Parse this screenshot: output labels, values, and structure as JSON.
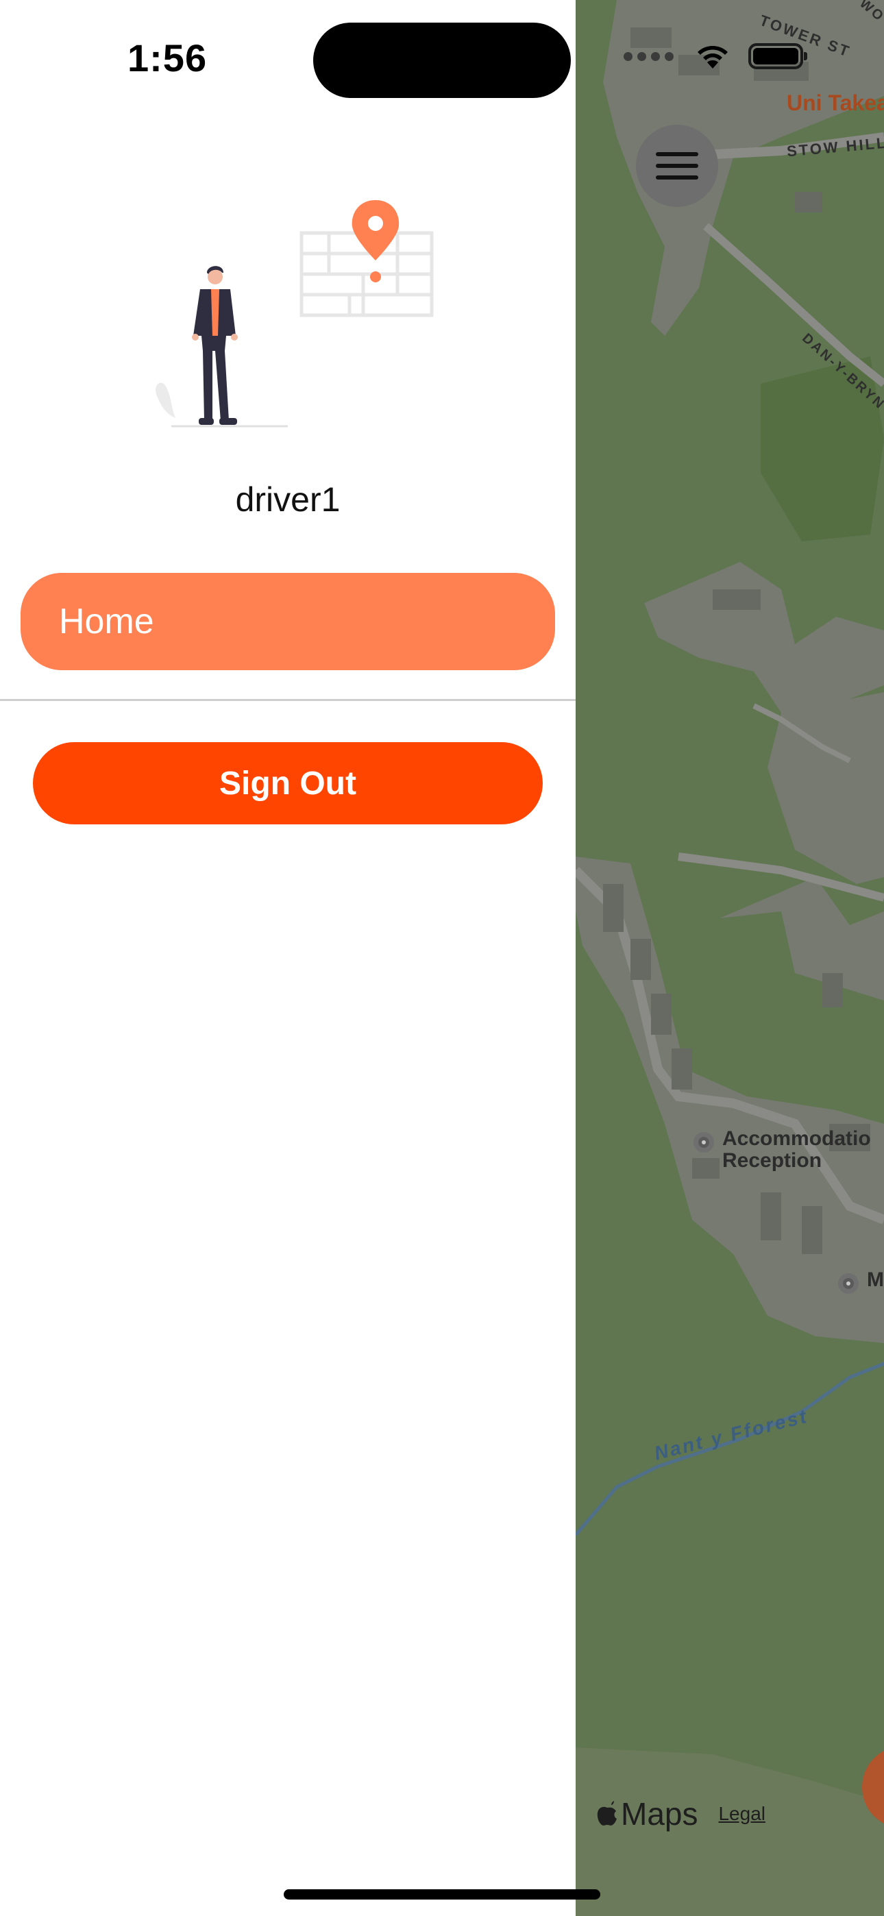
{
  "status_bar": {
    "time": "1:56",
    "icons": [
      "cellular-signal-icon",
      "wifi-icon",
      "battery-icon"
    ]
  },
  "drawer": {
    "illustration": "person-with-map-pin-illustration",
    "username": "driver1",
    "items": [
      {
        "label": "Home",
        "selected": true
      }
    ],
    "sign_out_label": "Sign Out"
  },
  "map": {
    "menu_icon": "hamburger-menu-icon",
    "labels": {
      "tower_st": "TOWER ST",
      "uni_takeaway": "Uni Takea",
      "stow_hill": "STOW HILL",
      "dan_y_bryn": "DAN-Y-BRYN R",
      "accommodation_line1": "Accommodatio",
      "accommodation_line2": "Reception",
      "poi_m": "M",
      "stream": "Nant y Fforest",
      "corner_fragment": "WO"
    },
    "attribution": {
      "logo_text": "Maps",
      "legal": "Legal"
    }
  },
  "colors": {
    "accent": "#ff8051",
    "sign_out": "#ff4500",
    "map_overlay": "#5f7650"
  }
}
